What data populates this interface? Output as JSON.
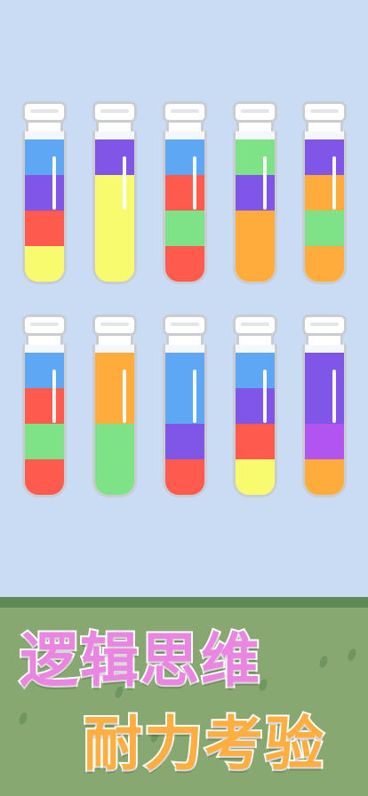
{
  "colors": {
    "blue": "#5ea7f5",
    "purple": "#7f56e8",
    "red": "#ff5a4e",
    "yellow": "#f7fb6d",
    "green": "#7ee387",
    "orange": "#ffac3d",
    "violet": "#b255f0"
  },
  "tubes": [
    {
      "name": "tube-1",
      "layers": [
        "yellow",
        "red",
        "purple",
        "blue"
      ]
    },
    {
      "name": "tube-2",
      "layers": [
        "yellow",
        "yellow",
        "yellow",
        "purple"
      ]
    },
    {
      "name": "tube-3",
      "layers": [
        "red",
        "green",
        "red",
        "blue"
      ]
    },
    {
      "name": "tube-4",
      "layers": [
        "orange",
        "orange",
        "purple",
        "green"
      ]
    },
    {
      "name": "tube-5",
      "layers": [
        "orange",
        "green",
        "orange",
        "purple"
      ]
    },
    {
      "name": "tube-6",
      "layers": [
        "red",
        "green",
        "red",
        "blue"
      ]
    },
    {
      "name": "tube-7",
      "layers": [
        "green",
        "green",
        "orange",
        "orange"
      ]
    },
    {
      "name": "tube-8",
      "layers": [
        "red",
        "purple",
        "blue",
        "blue"
      ]
    },
    {
      "name": "tube-9",
      "layers": [
        "yellow",
        "red",
        "purple",
        "blue"
      ]
    },
    {
      "name": "tube-10",
      "layers": [
        "orange",
        "violet",
        "purple",
        "purple"
      ]
    }
  ],
  "slogan": {
    "line1": "逻辑思维",
    "line2": "耐力考验"
  }
}
